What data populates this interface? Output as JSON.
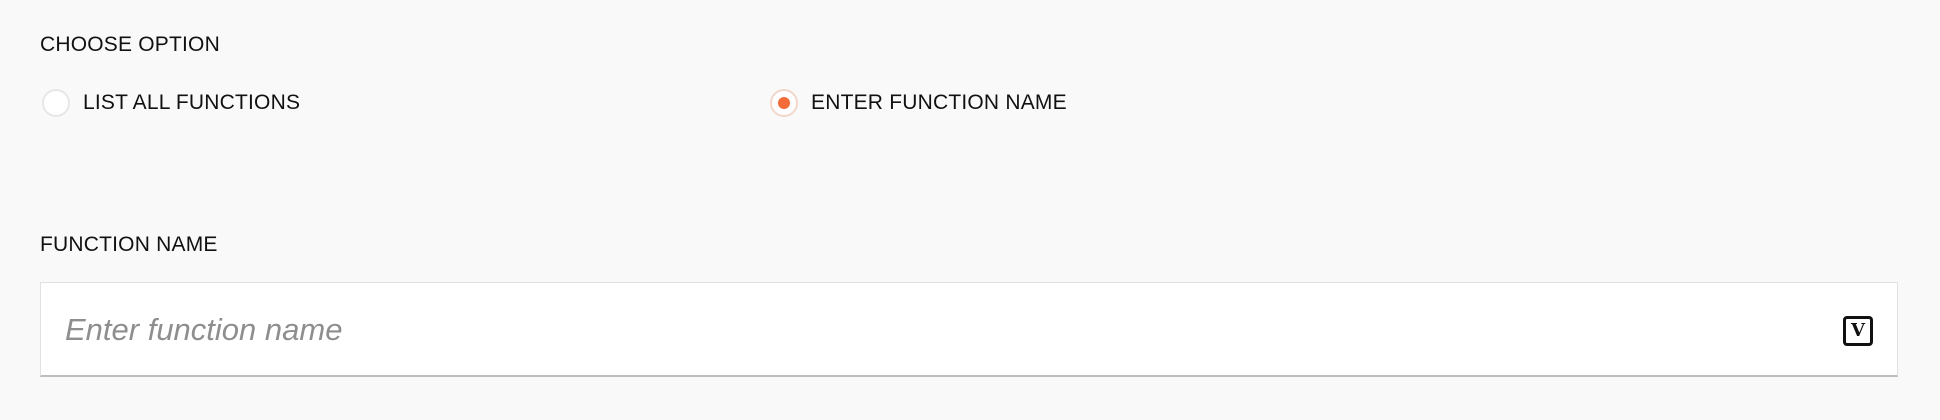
{
  "choose_option": {
    "label": "CHOOSE OPTION",
    "options": [
      {
        "label": "LIST ALL FUNCTIONS",
        "selected": false
      },
      {
        "label": "ENTER FUNCTION NAME",
        "selected": true
      }
    ]
  },
  "function_name": {
    "label": "FUNCTION NAME",
    "value": "",
    "placeholder": "Enter function name",
    "variable_icon": {
      "name": "variable-icon",
      "glyph": "V"
    }
  },
  "colors": {
    "accent": "#f26b38",
    "background": "#f9f9f9"
  }
}
